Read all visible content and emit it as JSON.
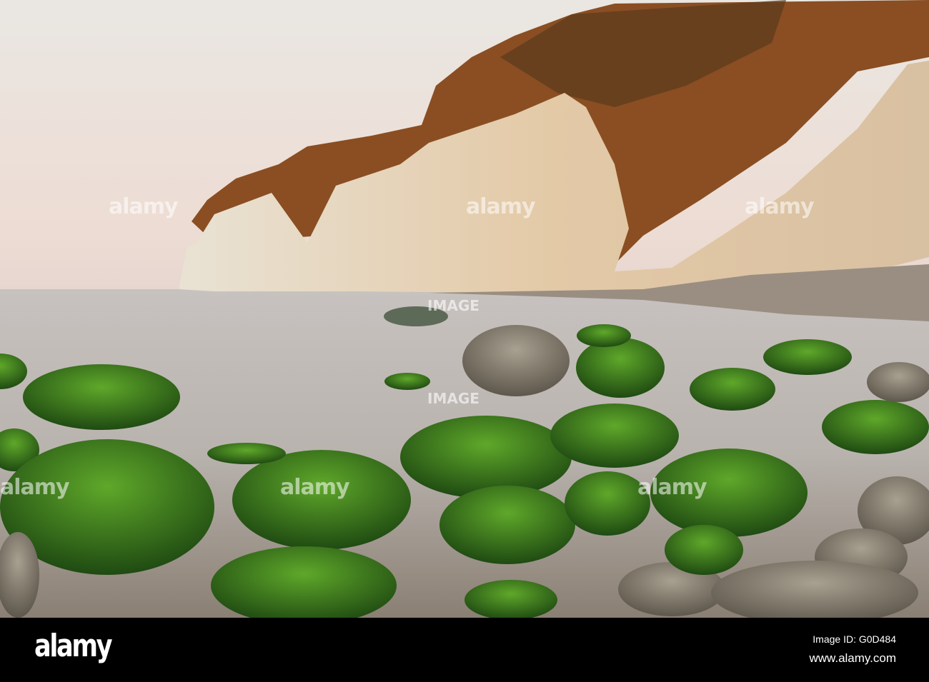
{
  "photo": {
    "subject": "chalk cliffs with mossy boulders",
    "watermark": "alamy",
    "watermark_small": "IMAGE"
  },
  "footer": {
    "logo": "alamy",
    "image_id": "Image ID: G0D484",
    "url": "www.alamy.com"
  }
}
